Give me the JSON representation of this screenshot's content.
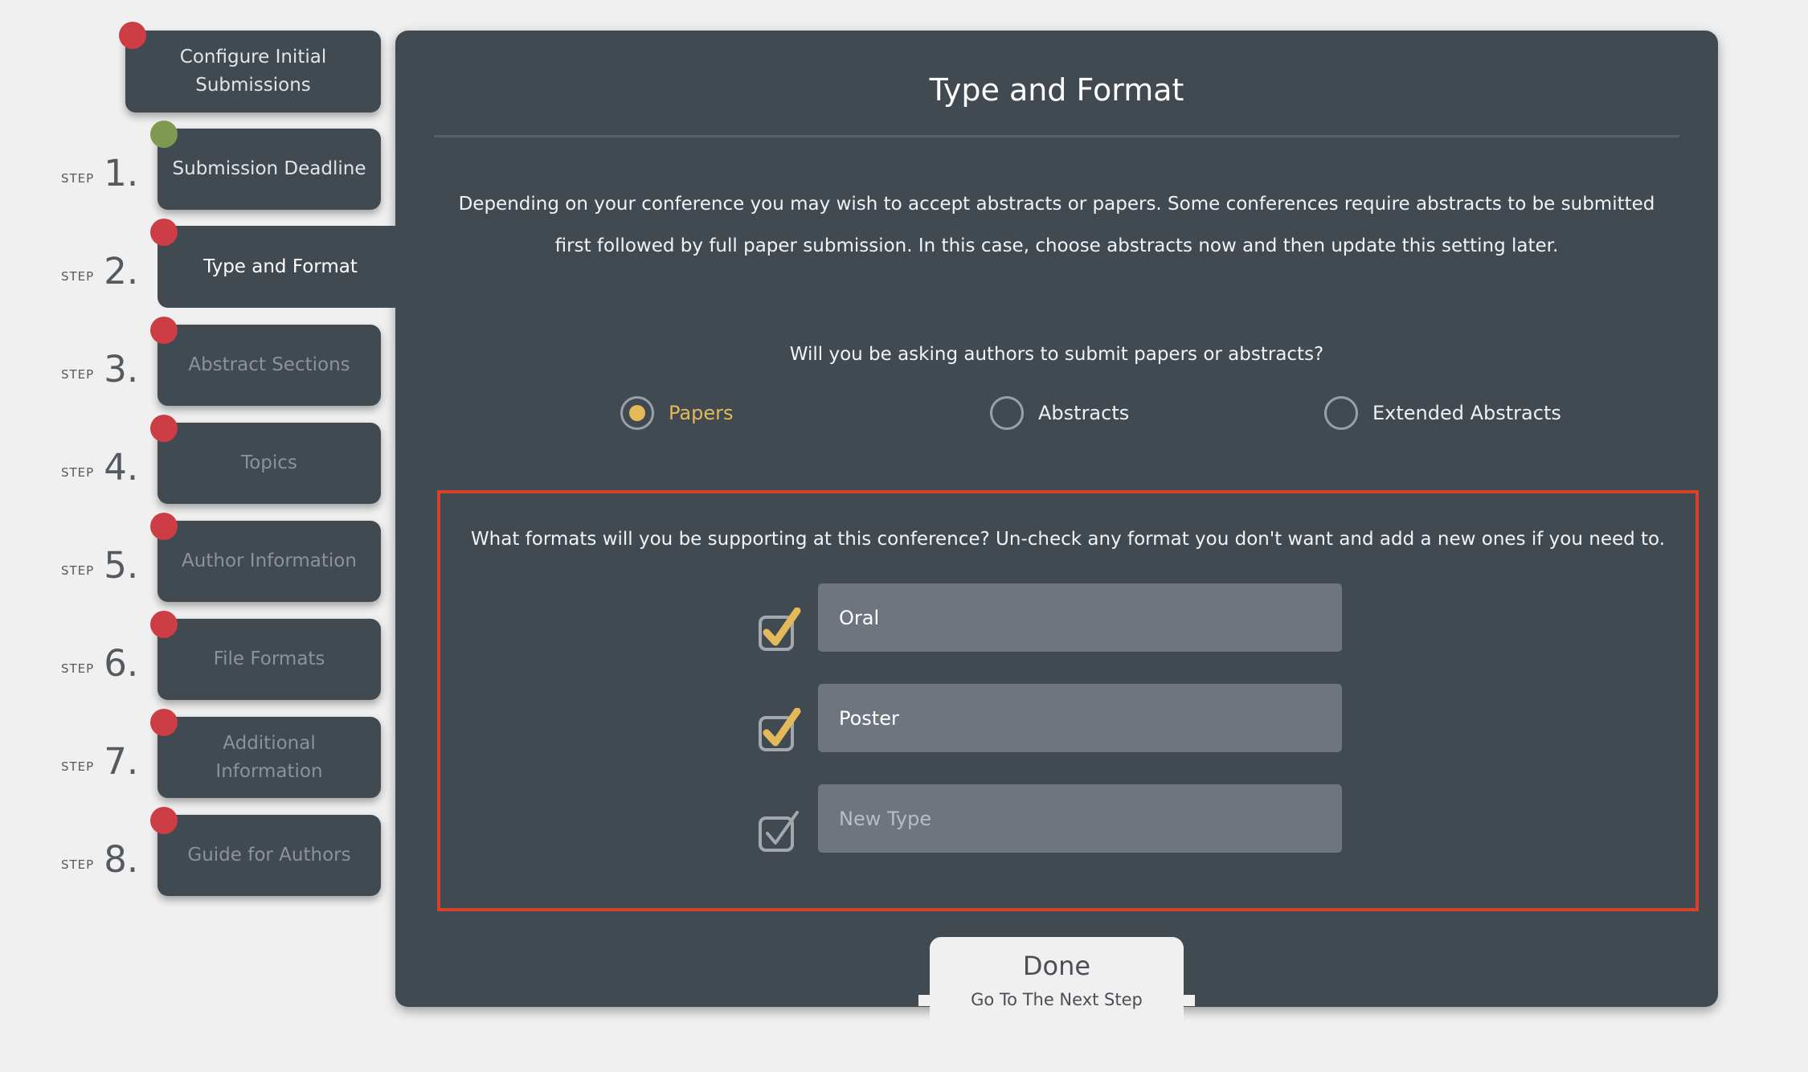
{
  "colors": {
    "panel": "#414951",
    "background": "#f0f0f0",
    "accent": "#e4b95a",
    "status_incomplete": "#cc3d45",
    "status_complete": "#7f9a50",
    "highlight_border": "#d9412d"
  },
  "sidebar": {
    "step_word": "STEP",
    "configure": {
      "label": "Configure Initial Submissions",
      "status": "incomplete"
    },
    "steps": [
      {
        "number": "1.",
        "label": "Submission Deadline",
        "status": "complete"
      },
      {
        "number": "2.",
        "label": "Type and Format",
        "status": "incomplete",
        "active": true
      },
      {
        "number": "3.",
        "label": "Abstract Sections",
        "status": "incomplete"
      },
      {
        "number": "4.",
        "label": "Topics",
        "status": "incomplete"
      },
      {
        "number": "5.",
        "label": "Author Information",
        "status": "incomplete"
      },
      {
        "number": "6.",
        "label": "File Formats",
        "status": "incomplete"
      },
      {
        "number": "7.",
        "label": "Additional Information",
        "status": "incomplete"
      },
      {
        "number": "8.",
        "label": "Guide for Authors",
        "status": "incomplete"
      }
    ]
  },
  "main": {
    "title": "Type and Format",
    "intro": "Depending on your conference you may wish to accept abstracts or papers. Some conferences require abstracts to be submitted first followed by full paper submission. In this case, choose abstracts now and then update this setting later.",
    "submission_question": "Will you be asking authors to submit papers or abstracts?",
    "submission_options": [
      {
        "label": "Papers",
        "selected": true
      },
      {
        "label": "Abstracts",
        "selected": false
      },
      {
        "label": "Extended Abstracts",
        "selected": false
      }
    ],
    "formats_question": "What formats will you be supporting at this conference? Un-check any format you don't want and add a new ones if you need to.",
    "formats": [
      {
        "value": "Oral",
        "placeholder": "",
        "checked": true
      },
      {
        "value": "Poster",
        "placeholder": "",
        "checked": true
      },
      {
        "value": "",
        "placeholder": "New Type",
        "checked": false
      }
    ],
    "done_button": {
      "label": "Done",
      "sublabel": "Go To The Next Step"
    }
  }
}
